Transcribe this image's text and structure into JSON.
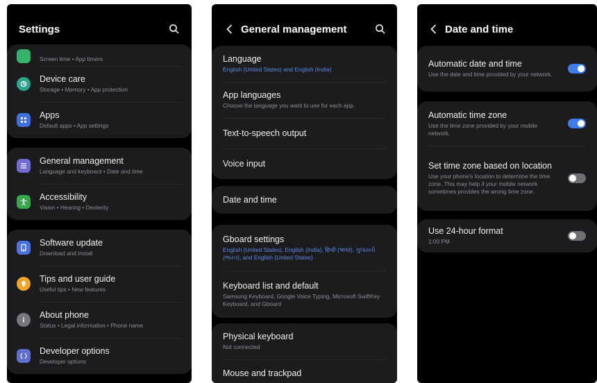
{
  "settings": {
    "title": "Settings",
    "group1": [
      {
        "label": "",
        "sub": "Screen time  •  App timers",
        "color": "#36b36b"
      },
      {
        "label": "Device care",
        "sub": "Storage  •  Memory  •  App protection",
        "color": "#2aa58c"
      },
      {
        "label": "Apps",
        "sub": "Default apps  •  App settings",
        "color": "#3f72e0"
      }
    ],
    "group2": [
      {
        "label": "General management",
        "sub": "Language and keyboard  •  Date and time",
        "color": "#6f6dd4"
      },
      {
        "label": "Accessibility",
        "sub": "Vision  •  Hearing  •  Dexterity",
        "color": "#37a64d"
      }
    ],
    "group3": [
      {
        "label": "Software update",
        "sub": "Download and install",
        "color": "#4b72e0"
      },
      {
        "label": "Tips and user guide",
        "sub": "Useful tips  •  New features",
        "color": "#f0a727"
      },
      {
        "label": "About phone",
        "sub": "Status  •  Legal information  •  Phone name",
        "color": "#77777d"
      },
      {
        "label": "Developer options",
        "sub": "Developer options",
        "color": "#5f6fd1"
      }
    ]
  },
  "general": {
    "title": "General management",
    "group1": [
      {
        "label": "Language",
        "sub": "English (United States) and English (India)",
        "blue": true
      },
      {
        "label": "App languages",
        "sub": "Choose the language you want to use for each app.",
        "blue": false
      },
      {
        "label": "Text-to-speech output",
        "sub": "",
        "blue": false
      },
      {
        "label": "Voice input",
        "sub": "",
        "blue": false
      }
    ],
    "group2": [
      {
        "label": "Date and time",
        "sub": "",
        "blue": false
      }
    ],
    "group3": [
      {
        "label": "Gboard settings",
        "sub": "English (United States), English (India), हिन्दी (भारत), ગુજરાતી (ભારત), and English (United States)",
        "blue": true
      },
      {
        "label": "Keyboard list and default",
        "sub": "Samsung Keyboard, Google Voice Typing, Microsoft SwiftKey Keyboard, and Gboard",
        "blue": false
      }
    ],
    "group4": [
      {
        "label": "Physical keyboard",
        "sub": "Not connected",
        "blue": false
      },
      {
        "label": "Mouse and trackpad",
        "sub": "",
        "blue": false
      }
    ]
  },
  "datetime": {
    "title": "Date and time",
    "group1": [
      {
        "label": "Automatic date and time",
        "sub": "Use the date and time provided by your network.",
        "on": true
      }
    ],
    "group2": [
      {
        "label": "Automatic time zone",
        "sub": "Use the time zone provided by your mobile network.",
        "on": true
      },
      {
        "label": "Set time zone based on location",
        "sub": "Use your phone's location to determine the time zone. This may help if your mobile network sometimes provides the wrong time zone.",
        "on": false
      }
    ],
    "group3": [
      {
        "label": "Use 24-hour format",
        "sub": "1:00 PM",
        "on": false
      }
    ]
  }
}
